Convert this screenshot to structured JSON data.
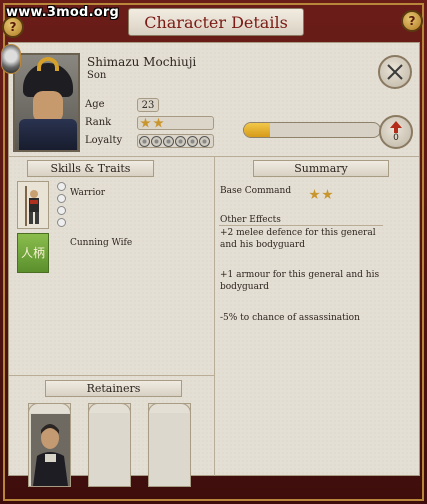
{
  "watermark": "www.3mod.org",
  "title": "Character Details",
  "help_icon_label": "?",
  "character": {
    "name": "Shimazu Mochiuji",
    "relation": "Son",
    "age_label": "Age",
    "age_value": "23",
    "rank_label": "Rank",
    "rank_stars": 2,
    "loyalty_label": "Loyalty",
    "loyalty_dots": 6
  },
  "progress_value": 0.19,
  "retainer_count": "0",
  "skills": {
    "heading": "Skills & Traits",
    "items": [
      {
        "label": "Warrior",
        "icon": "warrior-icon"
      },
      {
        "label": "Cunning Wife",
        "icon": "kanji-trait-icon"
      }
    ],
    "kanji": "人柄"
  },
  "summary": {
    "heading": "Summary",
    "base_command_label": "Base Command",
    "base_command_stars": 2,
    "other_effects_label": "Other Effects",
    "effects": [
      "+2 melee defence for this general and his bodyguard",
      "+1 armour for this general and his bodyguard",
      "-5% to chance of assassination"
    ]
  },
  "retainers": {
    "heading": "Retainers"
  },
  "colors": {
    "frame": "#5a1613",
    "title_text": "#7a1a14",
    "star": "#c9962e",
    "progress": "#e6b030",
    "kanji_tile": "#6da33a"
  }
}
